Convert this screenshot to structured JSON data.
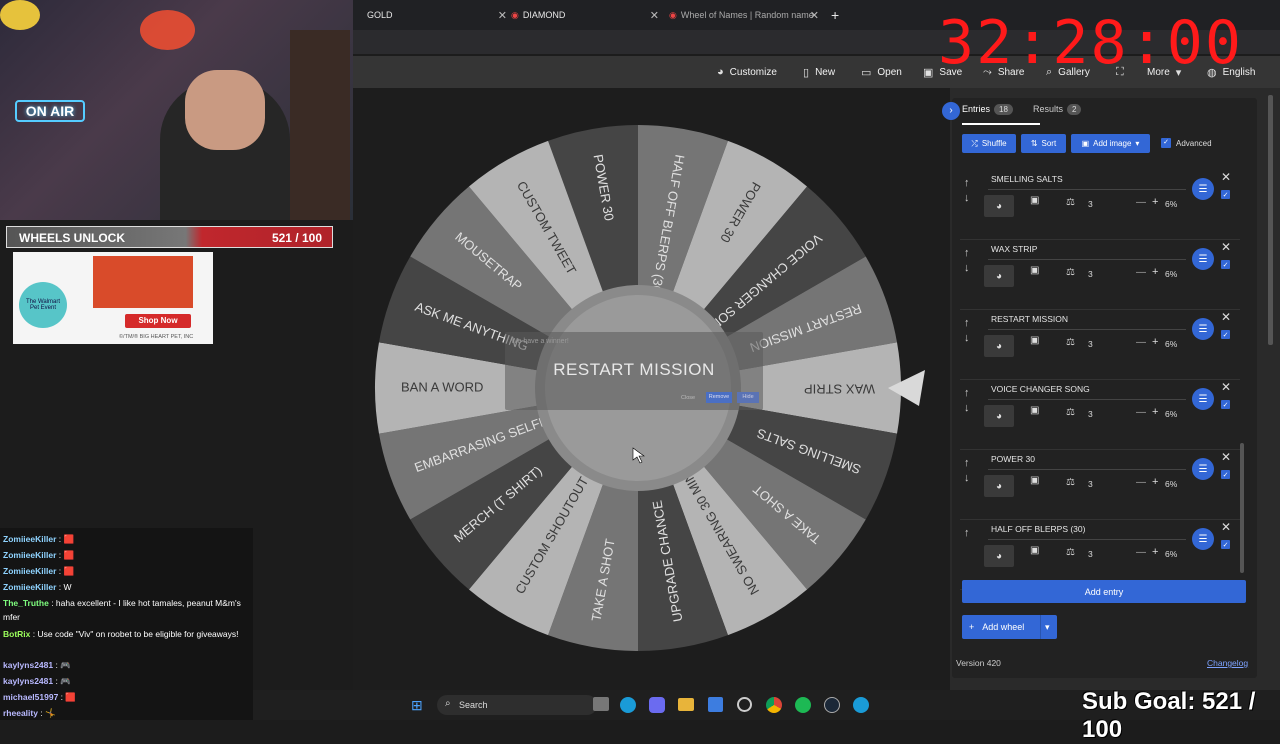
{
  "browser": {
    "tabs": [
      {
        "label": "GOLD"
      },
      {
        "label": "DIAMOND"
      },
      {
        "label": "Wheel of Names | Random name"
      }
    ],
    "new_tab_label": "+"
  },
  "toolbar": {
    "customize": "Customize",
    "new": "New",
    "open": "Open",
    "save": "Save",
    "share": "Share",
    "gallery": "Gallery",
    "more": "More",
    "language": "English"
  },
  "wheel": {
    "segments": [
      "POWER 30",
      "HALF OFF BLERPS (30)",
      "POWER 30",
      "VOICE CHANGER SONG",
      "RESTART MISSION",
      "WAX STRIP",
      "SMELLING SALTS",
      "TAKE A SHOT",
      "NO SWEARING 30 MIN",
      "UPGRADE CHANCE",
      "TAKE A SHOT",
      "CUSTOM SHOUTOUT",
      "MERCH (T SHIRT)",
      "EMBARRASING SELFIE",
      "BAN A WORD",
      "ASK ME ANYTHING",
      "MOUSETRAP",
      "CUSTOM TWEET"
    ],
    "colors": [
      "#454545",
      "#757575",
      "#b4b4b4"
    ],
    "pointer_color": "#d9d9d9"
  },
  "winner_dialog": {
    "heading": "We have a winner!",
    "winner": "RESTART MISSION",
    "close": "Close",
    "remove": "Remove",
    "hide": "Hide"
  },
  "panel": {
    "entries_tab": "Entries",
    "entries_count": "18",
    "results_tab": "Results",
    "results_count": "2",
    "shuffle": "Shuffle",
    "sort": "Sort",
    "add_image": "Add image",
    "advanced": "Advanced",
    "entries": [
      {
        "name": "SMELLING SALTS",
        "weight": "3",
        "pct": "6%"
      },
      {
        "name": "WAX STRIP",
        "weight": "3",
        "pct": "6%"
      },
      {
        "name": "RESTART MISSION",
        "weight": "3",
        "pct": "6%"
      },
      {
        "name": "VOICE CHANGER SONG",
        "weight": "3",
        "pct": "6%"
      },
      {
        "name": "POWER 30",
        "weight": "3",
        "pct": "6%"
      },
      {
        "name": "HALF OFF BLERPS (30)",
        "weight": "3",
        "pct": "6%"
      }
    ],
    "add_entry": "Add entry",
    "add_wheel": "Add wheel",
    "version": "Version 420",
    "changelog": "Changelog"
  },
  "taskbar": {
    "search": "Search"
  },
  "overlay": {
    "timer": "32:28:00",
    "unlock_title": "WHEELS UNLOCK",
    "unlock_count": "521 / 100",
    "on_air": "ON AIR",
    "ad_brand": "The Walmart Pet Event",
    "ad_button": "Shop Now",
    "ad_footer": "©/TM/® BIG HEART PET, INC",
    "subgoal": "Sub Goal: 521 / 100"
  },
  "chat": [
    {
      "user": "ZomiieeKiller",
      "msg": ": 🟥",
      "color": "#8fd3ff"
    },
    {
      "user": "ZomiieeKiller",
      "msg": ": 🟥",
      "color": "#8fd3ff"
    },
    {
      "user": "ZomiieeKiller",
      "msg": ": 🟥",
      "color": "#8fd3ff"
    },
    {
      "user": "ZomiieeKiller",
      "msg": ": W",
      "color": "#8fd3ff"
    },
    {
      "user": "The_Truthe",
      "msg": ": haha excellent - I like hot tamales, peanut M&m's mfer",
      "color": "#7fff7f"
    },
    {
      "user": "BotRix",
      "msg": ": Use code \"Viv\" on roobet to be eligible for giveaways!",
      "color": "#9cff5c"
    },
    {
      "user": "kaylyns2481",
      "msg": ": 🎮",
      "color": "#b9b9ff"
    },
    {
      "user": "kaylyns2481",
      "msg": ": 🎮",
      "color": "#b9b9ff"
    },
    {
      "user": "michael51997",
      "msg": ": 🟥",
      "color": "#b9b9ff"
    },
    {
      "user": "rheeality",
      "msg": ": 🤸",
      "color": "#b9b9ff"
    }
  ]
}
